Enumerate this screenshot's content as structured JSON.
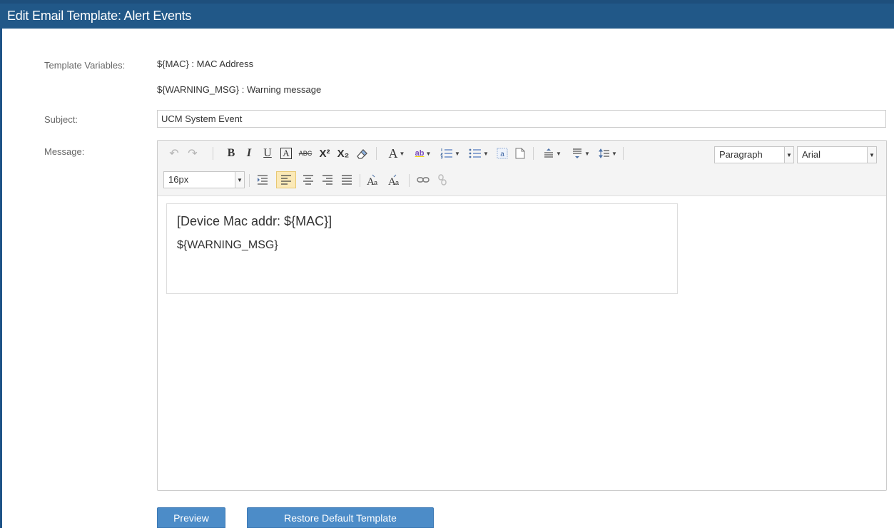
{
  "window": {
    "title": "Edit Email Template: Alert Events"
  },
  "template_variables": {
    "label": "Template Variables:",
    "items": [
      "${MAC} : MAC Address",
      "${WARNING_MSG} : Warning message"
    ]
  },
  "subject": {
    "label": "Subject:",
    "value": "UCM System Event"
  },
  "message": {
    "label": "Message:",
    "toolbar": {
      "undo_icon": "undo-icon",
      "redo_icon": "redo-icon",
      "bold": "B",
      "italic": "I",
      "underline": "U",
      "boxed": "A",
      "strike": "ABC",
      "superscript": "X²",
      "subscript": "X₂",
      "font_color": "A",
      "highlight": "ab",
      "format_select": "Paragraph",
      "font_select": "Arial",
      "size_select": "16px"
    },
    "body_lines": [
      "[Device Mac addr: ${MAC}]",
      "${WARNING_MSG}"
    ]
  },
  "buttons": {
    "preview": "Preview",
    "restore": "Restore Default Template"
  },
  "colors": {
    "title_bg": "#215888",
    "button_bg": "#4c8cc8",
    "active_tool": "#fbe9b7"
  }
}
